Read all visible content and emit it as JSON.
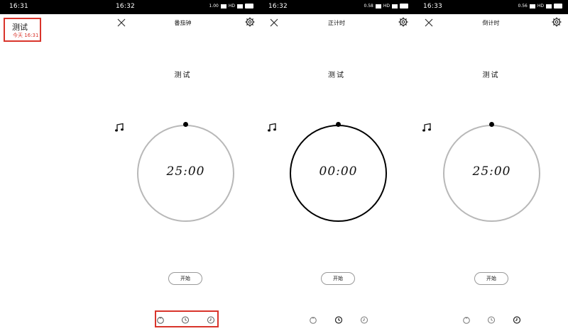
{
  "screens": [
    {
      "status_time": "16:31",
      "task": {
        "title": "测试",
        "subtitle": "今天 16:31"
      }
    },
    {
      "status_time": "16:32",
      "mode_title": "番茄钟",
      "task_name": "测试",
      "time": "25:00",
      "start_label": "开始"
    },
    {
      "status_time": "16:32",
      "mode_title": "正计时",
      "task_name": "测试",
      "time": "00:00",
      "start_label": "开始"
    },
    {
      "status_time": "16:33",
      "mode_title": "倒计时",
      "task_name": "测试",
      "time": "25:00",
      "start_label": "开始"
    }
  ],
  "icons": {
    "close": "close-icon",
    "settings": "gear-icon",
    "music": "music-note-icon",
    "nav_pomodoro": "tomato-icon",
    "nav_stopwatch": "stopwatch-icon",
    "nav_countdown": "countdown-icon"
  },
  "colors": {
    "highlight": "#d9342b",
    "ring_inactive": "#b8b8b8",
    "ring_active": "#000000"
  }
}
